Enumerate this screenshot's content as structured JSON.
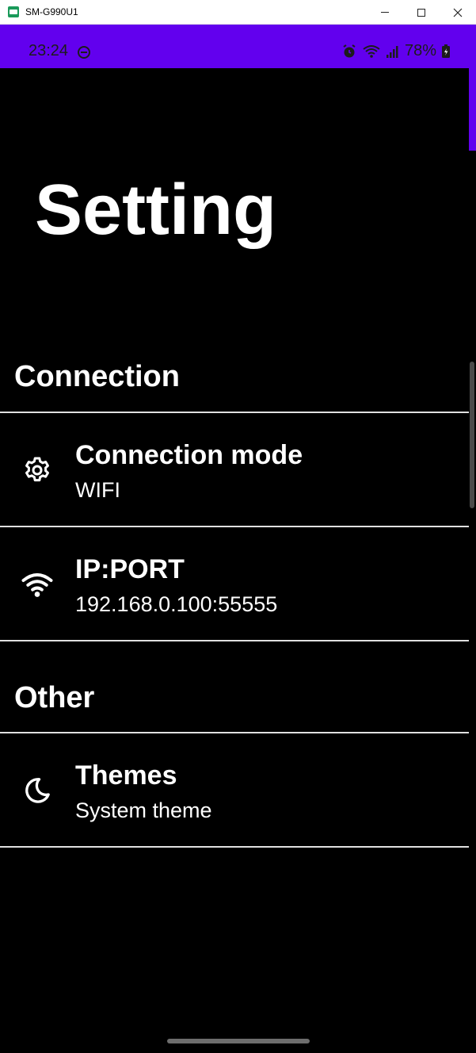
{
  "window": {
    "title": "SM-G990U1"
  },
  "status_bar": {
    "time": "23:24",
    "battery": "78%"
  },
  "page": {
    "title": "Setting"
  },
  "sections": [
    {
      "header": "Connection",
      "items": [
        {
          "icon": "gear-icon",
          "title": "Connection mode",
          "summary": "WIFI"
        },
        {
          "icon": "wifi-icon",
          "title": "IP:PORT",
          "summary": "192.168.0.100:55555"
        }
      ]
    },
    {
      "header": "Other",
      "items": [
        {
          "icon": "moon-icon",
          "title": "Themes",
          "summary": "System theme"
        }
      ]
    }
  ],
  "colors": {
    "accent": "#6200ee",
    "background": "#000000",
    "text": "#ffffff",
    "divider": "#e0e0e0"
  }
}
